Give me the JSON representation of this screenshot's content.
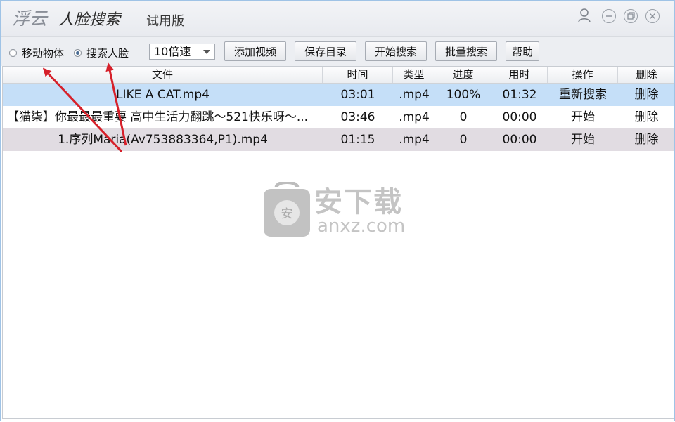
{
  "app": {
    "logo_left": "浮云",
    "logo_right": "人脸搜索",
    "edition": "试用版"
  },
  "titlebar_icons": [
    "user-icon",
    "minimize-icon",
    "restore-icon",
    "close-icon"
  ],
  "toolbar": {
    "radio_moving": "移动物体",
    "radio_face": "搜索人脸",
    "selected_radio": "搜索人脸",
    "speed_value": "10倍速",
    "buttons": [
      "添加视频",
      "保存目录",
      "开始搜索",
      "批量搜索",
      "帮助"
    ]
  },
  "table": {
    "headers": [
      "文件",
      "时间",
      "类型",
      "进度",
      "用时",
      "操作",
      "删除"
    ],
    "rows": [
      {
        "file": "LIKE A CAT.mp4",
        "time": "03:01",
        "type": ".mp4",
        "progress": "100%",
        "elapsed": "01:32",
        "action": "重新搜索",
        "delete": "删除",
        "state": "selected"
      },
      {
        "file": "【猫柒】你最最最重要 高中生活力翻跳～521快乐呀～...",
        "time": "03:46",
        "type": ".mp4",
        "progress": "0",
        "elapsed": "00:00",
        "action": "开始",
        "delete": "删除",
        "state": "normal"
      },
      {
        "file": "1.序列Maria(Av753883364,P1).mp4",
        "time": "01:15",
        "type": ".mp4",
        "progress": "0",
        "elapsed": "00:00",
        "action": "开始",
        "delete": "删除",
        "state": "hover"
      }
    ]
  },
  "watermark": {
    "cn": "安下载",
    "url": "anxz.com"
  },
  "colors": {
    "selected_row": "#c5dff8",
    "hover_row": "#e1dce2",
    "annotation_arrow": "#d6202a"
  }
}
